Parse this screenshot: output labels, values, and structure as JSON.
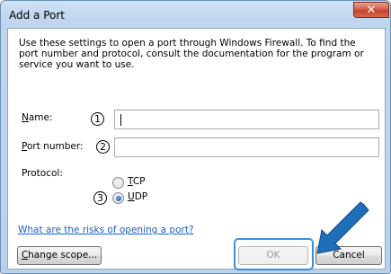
{
  "window": {
    "title": "Add a Port",
    "close_glyph": "✕"
  },
  "description": "Use these settings to open a port through Windows Firewall. To find the port number and protocol, consult the documentation for the program or service you want to use.",
  "form": {
    "name_label_accel": "N",
    "name_label_rest": "ame:",
    "name_value": "",
    "port_label_accel": "P",
    "port_label_rest": "ort number:",
    "port_value": "",
    "protocol_label": "Protocol:",
    "tcp_accel": "T",
    "tcp_rest": "CP",
    "udp_accel": "U",
    "udp_rest": "DP",
    "selected_protocol": "UDP"
  },
  "markers": {
    "one": "1",
    "two": "2",
    "three": "3"
  },
  "link_text": "What are the risks of opening a port?",
  "buttons": {
    "change_scope_accel": "C",
    "change_scope_rest": "hange scope...",
    "ok": "OK",
    "cancel": "Cancel"
  },
  "colors": {
    "link": "#1a5fc8",
    "highlight": "#3a8fd9",
    "arrow": "#1f6fb8",
    "close_button": "#c6402a"
  }
}
